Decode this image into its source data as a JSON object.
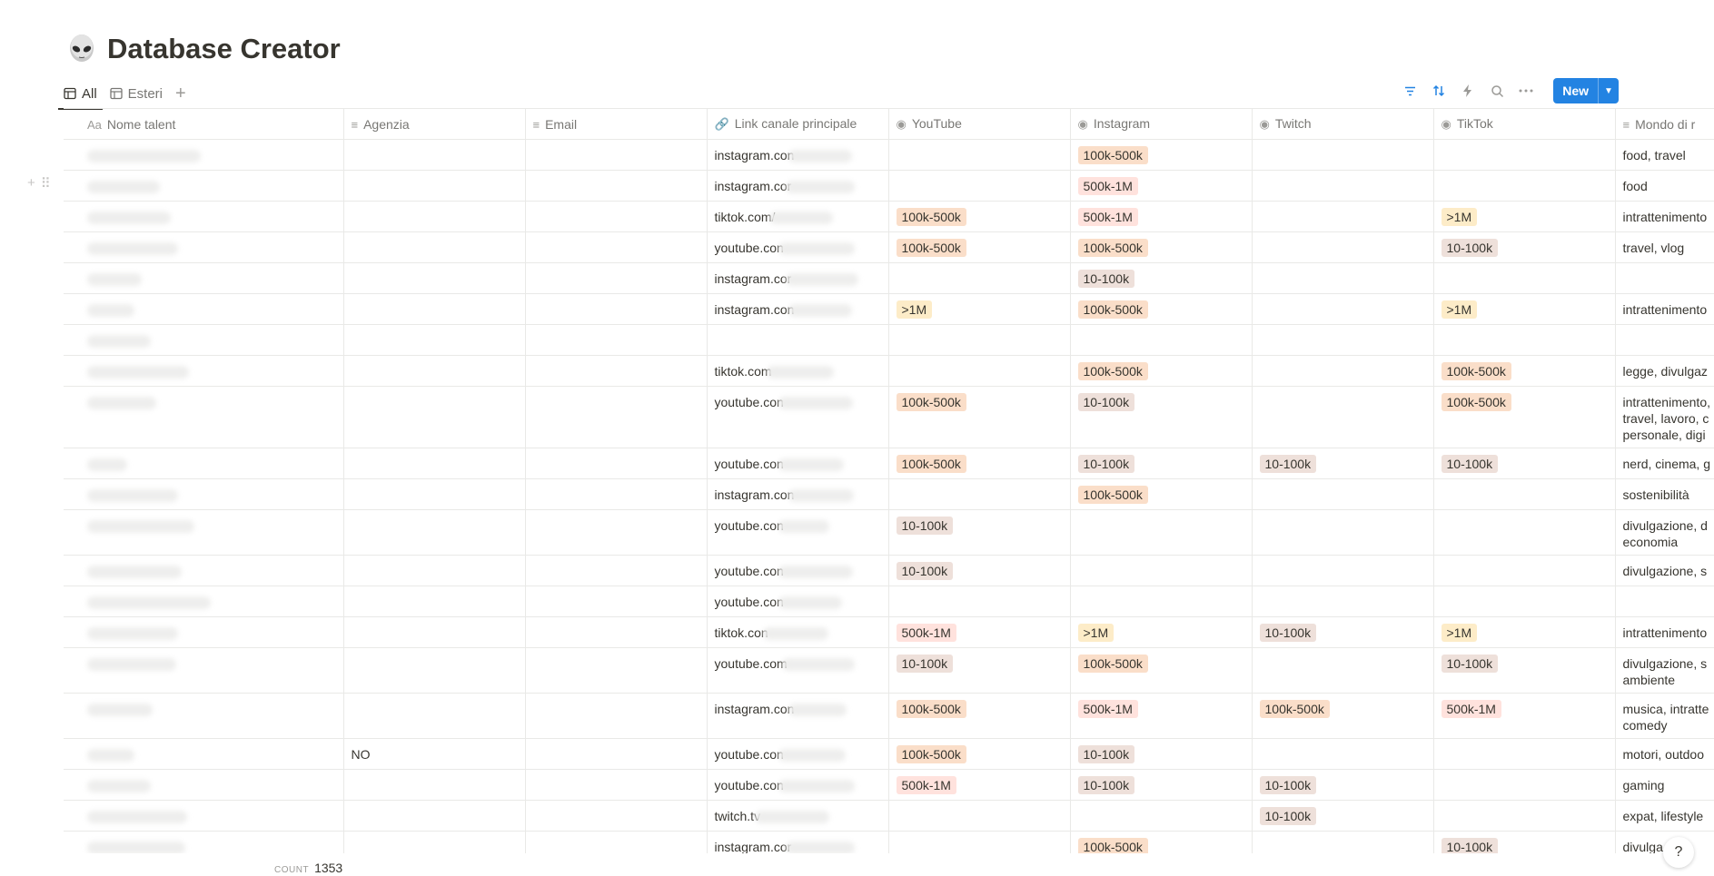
{
  "page": {
    "title": "Database Creator",
    "emoji_icon": "alien-icon"
  },
  "views": {
    "items": [
      {
        "label": "All",
        "icon": "table-icon",
        "active": true
      },
      {
        "label": "Esteri",
        "icon": "table-icon",
        "active": false
      }
    ],
    "add_icon": "plus-icon"
  },
  "toolbar": {
    "new_label": "New",
    "icons": [
      "filter-icon",
      "sort-icon",
      "automation-icon",
      "search-icon",
      "more-icon"
    ]
  },
  "columns": [
    {
      "label": "Nome talent",
      "icon": "Aa"
    },
    {
      "label": "Agenzia",
      "icon": "≡"
    },
    {
      "label": "Email",
      "icon": "≡"
    },
    {
      "label": "Link canale principale",
      "icon": "🔗"
    },
    {
      "label": "YouTube",
      "icon": "◉"
    },
    {
      "label": "Instagram",
      "icon": "◉"
    },
    {
      "label": "Twitch",
      "icon": "◉"
    },
    {
      "label": "TikTok",
      "icon": "◉"
    },
    {
      "label": "Mondo di r",
      "icon": "≡"
    }
  ],
  "tag_colors": {
    "100k-500k": "#fadec9",
    "500k-1M": "#ffe2dd",
    ">1M": "#fdecc8",
    "10-100k": "#eee0da"
  },
  "rows": [
    {
      "agenzia": "",
      "link": "instagram.con",
      "youtube": "",
      "instagram": "100k-500k",
      "twitch": "",
      "tiktok": "",
      "mondo": "food, travel"
    },
    {
      "agenzia": "",
      "link": "instagram.cor",
      "youtube": "",
      "instagram": "500k-1M",
      "twitch": "",
      "tiktok": "",
      "mondo": "food"
    },
    {
      "agenzia": "",
      "link": "tiktok.com/",
      "youtube": "100k-500k",
      "instagram": "500k-1M",
      "twitch": "",
      "tiktok": ">1M",
      "mondo": "intrattenimento"
    },
    {
      "agenzia": "",
      "link": "youtube.con",
      "youtube": "100k-500k",
      "instagram": "100k-500k",
      "twitch": "",
      "tiktok": "10-100k",
      "mondo": "travel, vlog"
    },
    {
      "agenzia": "",
      "link": "instagram.cor",
      "youtube": "",
      "instagram": "10-100k",
      "twitch": "",
      "tiktok": "",
      "mondo": ""
    },
    {
      "agenzia": "",
      "link": "instagram.con",
      "youtube": ">1M",
      "instagram": "100k-500k",
      "twitch": "",
      "tiktok": ">1M",
      "mondo": "intrattenimento"
    },
    {
      "agenzia": "",
      "link": "",
      "youtube": "",
      "instagram": "",
      "twitch": "",
      "tiktok": "",
      "mondo": ""
    },
    {
      "agenzia": "",
      "link": "tiktok.com",
      "youtube": "",
      "instagram": "100k-500k",
      "twitch": "",
      "tiktok": "100k-500k",
      "mondo": "legge, divulgaz"
    },
    {
      "agenzia": "",
      "link": "youtube.con",
      "youtube": "100k-500k",
      "instagram": "10-100k",
      "twitch": "",
      "tiktok": "100k-500k",
      "mondo": "intrattenimento, travel, lavoro, c personale, digi"
    },
    {
      "agenzia": "",
      "link": "youtube.con",
      "youtube": "100k-500k",
      "instagram": "10-100k",
      "twitch": "10-100k",
      "tiktok": "10-100k",
      "mondo": "nerd, cinema, g"
    },
    {
      "agenzia": "",
      "link": "instagram.con",
      "youtube": "",
      "instagram": "100k-500k",
      "twitch": "",
      "tiktok": "",
      "mondo": "sostenibilità"
    },
    {
      "agenzia": "",
      "link": "youtube.con",
      "youtube": "10-100k",
      "instagram": "",
      "twitch": "",
      "tiktok": "",
      "mondo": "divulgazione, d economia"
    },
    {
      "agenzia": "",
      "link": "youtube.con",
      "youtube": "10-100k",
      "instagram": "",
      "twitch": "",
      "tiktok": "",
      "mondo": "divulgazione, s"
    },
    {
      "agenzia": "",
      "link": "youtube.con",
      "youtube": "",
      "instagram": "",
      "twitch": "",
      "tiktok": "",
      "mondo": ""
    },
    {
      "agenzia": "",
      "link": "tiktok.con",
      "youtube": "500k-1M",
      "instagram": ">1M",
      "twitch": "10-100k",
      "tiktok": ">1M",
      "mondo": "intrattenimento"
    },
    {
      "agenzia": "",
      "link": "youtube.com",
      "youtube": "10-100k",
      "instagram": "100k-500k",
      "twitch": "",
      "tiktok": "10-100k",
      "mondo": "divulgazione, s ambiente"
    },
    {
      "agenzia": "",
      "link": "instagram.con",
      "youtube": "100k-500k",
      "instagram": "500k-1M",
      "twitch": "100k-500k",
      "tiktok": "500k-1M",
      "mondo": "musica, intratte comedy"
    },
    {
      "agenzia": "NO",
      "link": "youtube.con",
      "youtube": "100k-500k",
      "instagram": "10-100k",
      "twitch": "",
      "tiktok": "",
      "mondo": "motori, outdoo"
    },
    {
      "agenzia": "",
      "link": "youtube.con",
      "youtube": "500k-1M",
      "instagram": "10-100k",
      "twitch": "10-100k",
      "tiktok": "",
      "mondo": "gaming"
    },
    {
      "agenzia": "",
      "link": "twitch.tv",
      "youtube": "",
      "instagram": "",
      "twitch": "10-100k",
      "tiktok": "",
      "mondo": "expat, lifestyle"
    },
    {
      "agenzia": "",
      "link": "instagram.cor",
      "youtube": "",
      "instagram": "100k-500k",
      "twitch": "",
      "tiktok": "10-100k",
      "mondo": "divulga s"
    }
  ],
  "footer": {
    "count_label": "COUNT",
    "count_value": "1353"
  },
  "help": {
    "label": "?"
  }
}
